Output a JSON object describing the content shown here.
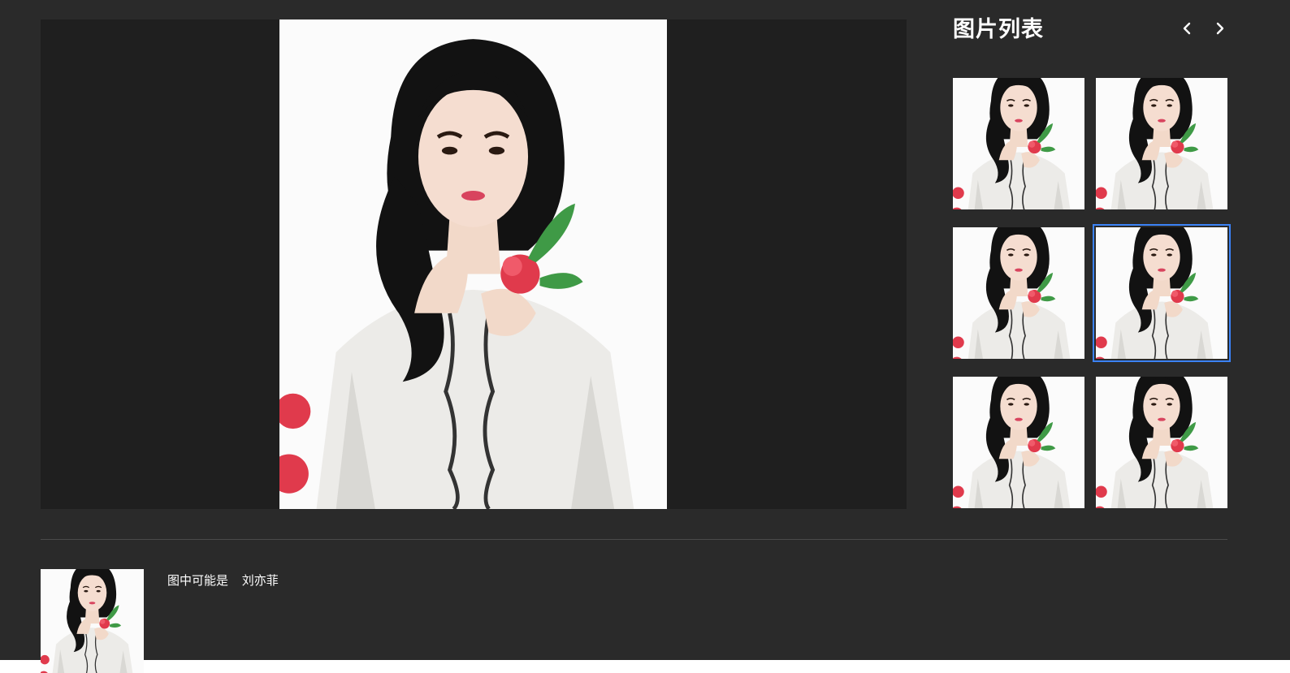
{
  "panel": {
    "title": "图片列表",
    "prev_icon": "chevron-left-icon",
    "next_icon": "chevron-right-icon"
  },
  "thumbnails": [
    {
      "selected": false
    },
    {
      "selected": false
    },
    {
      "selected": false
    },
    {
      "selected": true
    },
    {
      "selected": false
    },
    {
      "selected": false
    }
  ],
  "recognition": {
    "prefix": "图中可能是",
    "name": "刘亦菲"
  },
  "colors": {
    "background": "#2a2a2a",
    "viewer_background": "#1f1f1f",
    "selected_outline": "#3b82f6",
    "text": "#ffffff"
  }
}
